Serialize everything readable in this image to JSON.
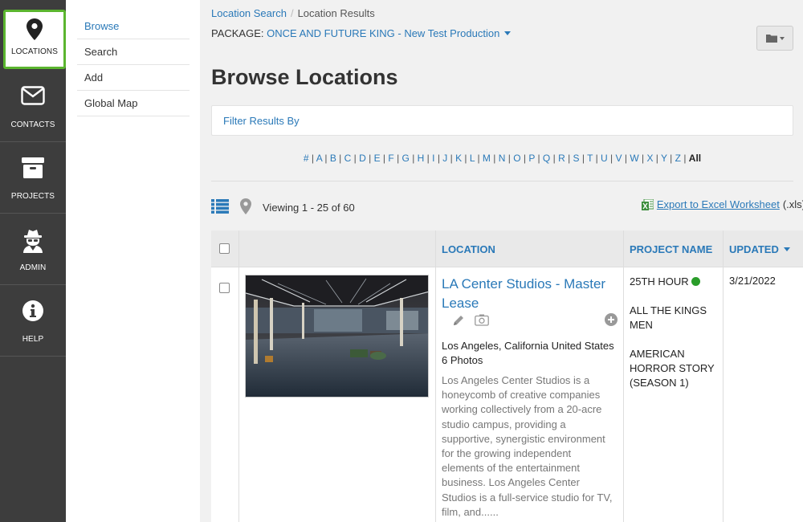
{
  "leftnav": [
    {
      "icon": "map-pin-icon",
      "label": "LOCATIONS",
      "active": true
    },
    {
      "icon": "envelope-icon",
      "label": "CONTACTS"
    },
    {
      "icon": "archive-box-icon",
      "label": "PROJECTS"
    },
    {
      "icon": "spy-agent-icon",
      "label": "ADMIN"
    },
    {
      "icon": "info-circle-icon",
      "label": "HELP"
    }
  ],
  "subnav": [
    "Browse",
    "Search",
    "Add",
    "Global Map"
  ],
  "breadcrumb": {
    "link": "Location Search",
    "current": "Location Results"
  },
  "package": {
    "label": "PACKAGE:",
    "value": "ONCE AND FUTURE KING - New Test Production"
  },
  "page_title": "Browse Locations",
  "filter_label": "Filter Results By",
  "alphabet": [
    "#",
    "A",
    "B",
    "C",
    "D",
    "E",
    "F",
    "G",
    "H",
    "I",
    "J",
    "K",
    "L",
    "M",
    "N",
    "O",
    "P",
    "Q",
    "R",
    "S",
    "T",
    "U",
    "V",
    "W",
    "X",
    "Y",
    "Z"
  ],
  "alphabet_current": "All",
  "viewing": "Viewing 1 - 25 of 60",
  "export": {
    "link": "Export to Excel Worksheet",
    "suffix": "(.xls)"
  },
  "table": {
    "headers": {
      "location": "LOCATION",
      "project": "PROJECT NAME",
      "updated": "UPDATED"
    },
    "rows": [
      {
        "title": "LA Center Studios - Master Lease",
        "address": "Los Angeles, California United States",
        "photos": "6 Photos",
        "description": "Los Angeles Center Studios is a honeycomb of creative companies working collectively from a 20-acre studio campus, providing a supportive, synergistic environment for the growing independent elements of the entertainment business. Los Angeles Center Studios is a full-service studio for TV, film, and......",
        "projects": [
          "25TH HOUR",
          "ALL THE KINGS MEN",
          "AMERICAN HORROR STORY (SEASON 1)"
        ],
        "updated": "3/21/2022"
      }
    ]
  },
  "colors": {
    "accent": "#2a79b8",
    "sidebar": "#3d3d3d",
    "active_border": "#5bb52f",
    "status_green": "#2a9d2a"
  }
}
